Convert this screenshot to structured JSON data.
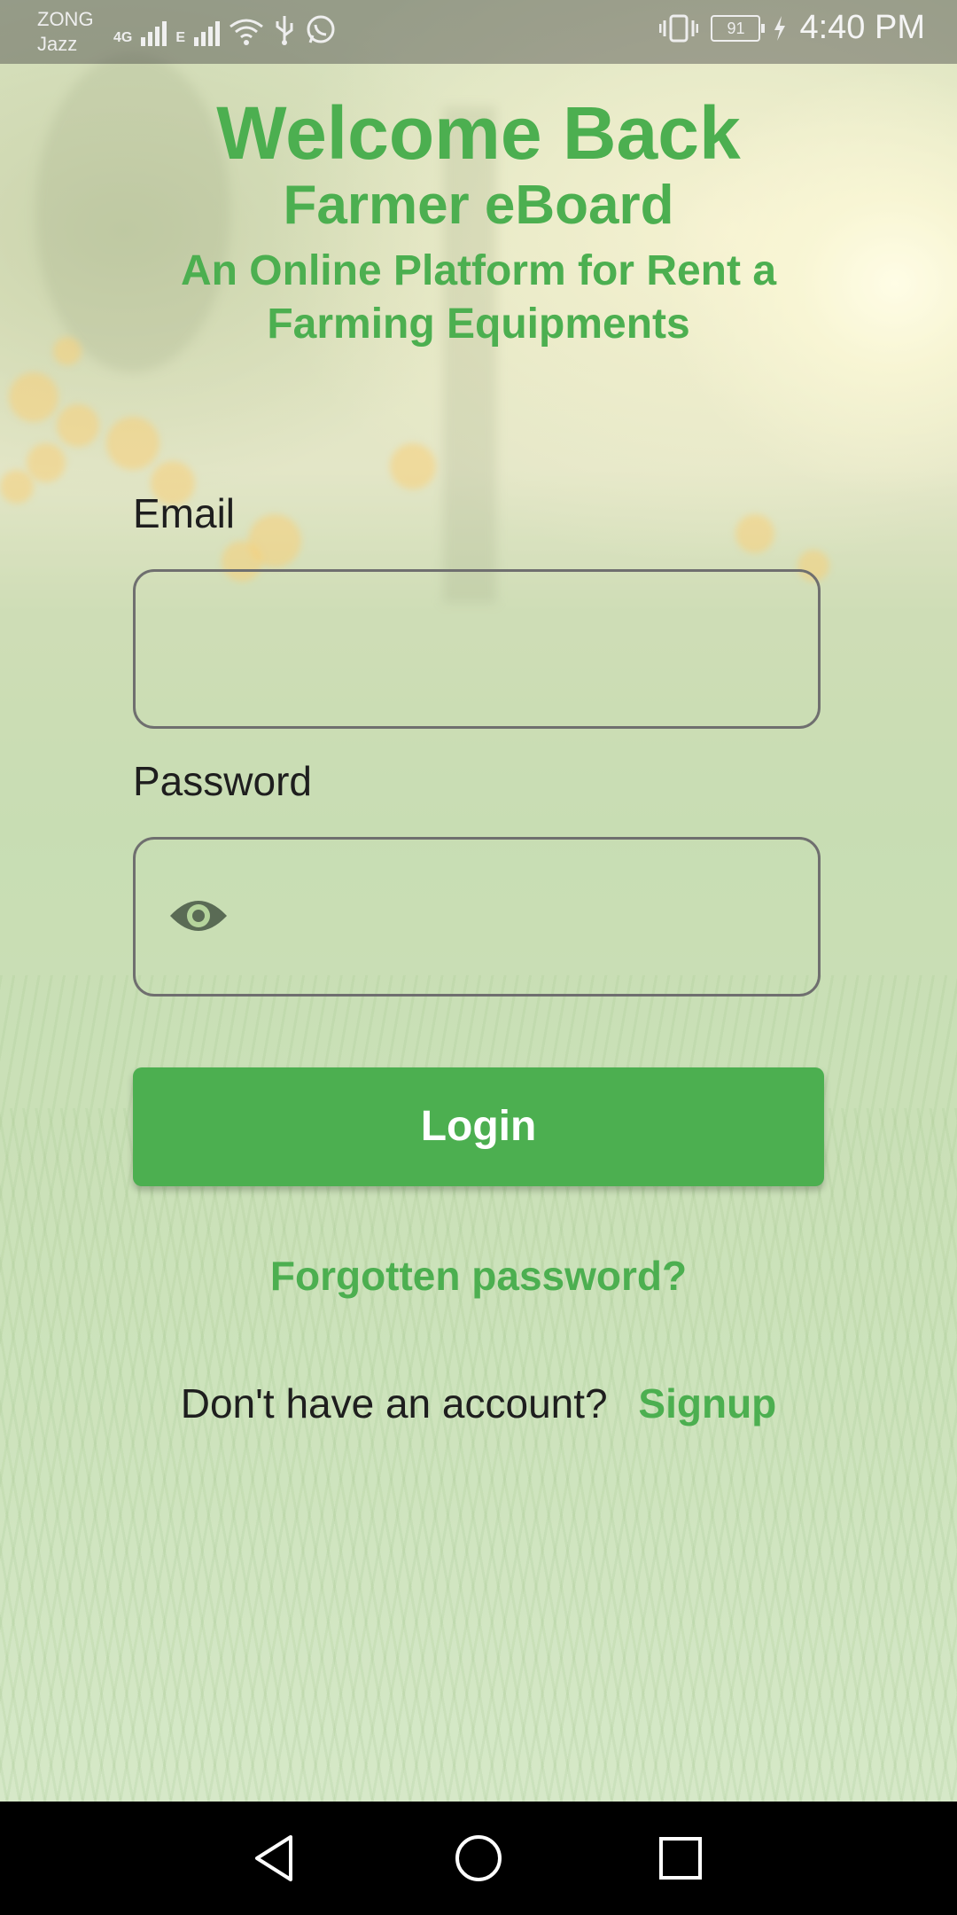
{
  "status_bar": {
    "carrier_line1": "ZONG",
    "carrier_line2": "Jazz",
    "network_1": "4G",
    "network_2": "E",
    "battery": "91",
    "time": "4:40 PM"
  },
  "header": {
    "welcome": "Welcome Back",
    "app_name": "Farmer eBoard",
    "tagline_line1": "An Online Platform for Rent a",
    "tagline_line2": "Farming Equipments"
  },
  "form": {
    "email_label": "Email",
    "email_value": "",
    "password_label": "Password",
    "password_value": "",
    "login_label": "Login",
    "forgot_label": "Forgotten password?",
    "no_account_text": "Don't have an account?",
    "signup_label": "Signup"
  },
  "colors": {
    "accent": "#4caf50",
    "text": "#1e1e1e",
    "navbar": "#000000"
  },
  "icons": [
    "signal-icon",
    "wifi-icon",
    "usb-icon",
    "whatsapp-icon",
    "vibrate-icon",
    "battery-icon",
    "charging-icon",
    "eye-icon",
    "back-icon",
    "home-icon",
    "recents-icon"
  ]
}
